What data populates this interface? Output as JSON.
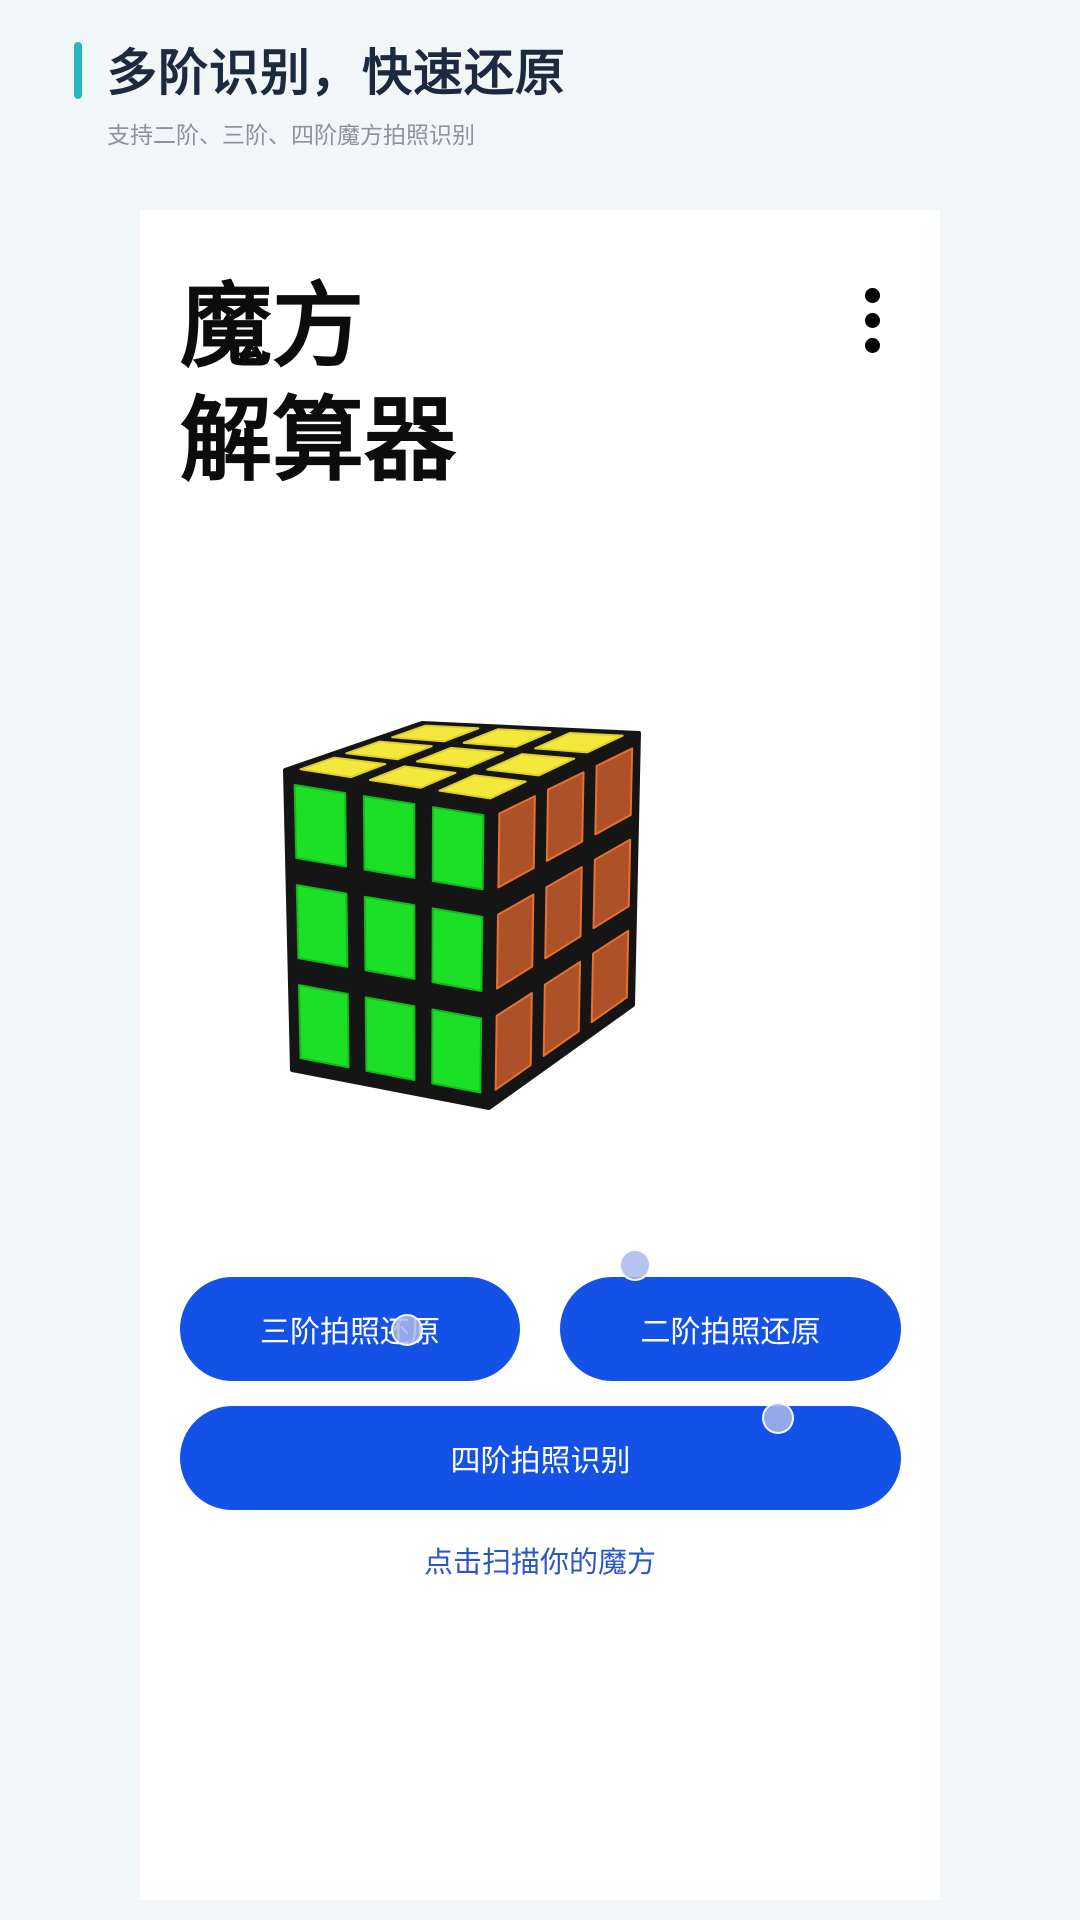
{
  "promo": {
    "title": "多阶识别，快速还原",
    "subtitle": "支持二阶、三阶、四阶魔方拍照识别",
    "accent_color": "#28b6c4"
  },
  "app": {
    "title_line1": "魔方",
    "title_line2": "解算器",
    "menu_icon": "more-vert-icon"
  },
  "cube": {
    "icon": "rubiks-cube-icon",
    "top_color": "#f5e83c",
    "front_color": "#1ce025",
    "side_color": "#ad5128"
  },
  "buttons": {
    "solve_3x3": "三阶拍照还原",
    "solve_2x2": "二阶拍照还原",
    "recognize_4x4": "四阶拍照识别",
    "color": "#1451e6"
  },
  "scan_link": "点击扫描你的魔方"
}
